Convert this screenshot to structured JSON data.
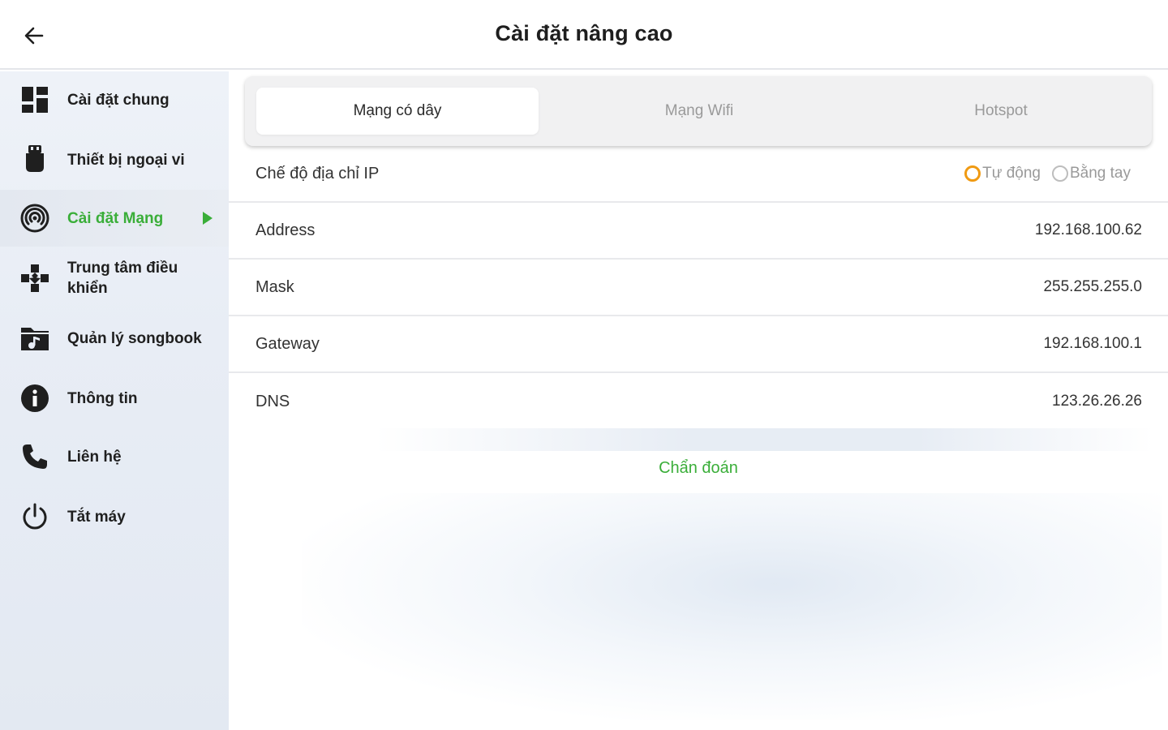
{
  "header": {
    "title": "Cài đặt nâng cao"
  },
  "sidebar": {
    "items": [
      {
        "label": "Cài đặt chung",
        "icon": "dashboard-icon"
      },
      {
        "label": "Thiết bị ngoại vi",
        "icon": "peripheral-icon"
      },
      {
        "label": "Cài đặt Mạng",
        "icon": "network-icon",
        "active": true
      },
      {
        "label": "Trung tâm điều khiển",
        "icon": "gamepad-icon"
      },
      {
        "label": "Quản lý songbook",
        "icon": "music-folder-icon"
      },
      {
        "label": "Thông tin",
        "icon": "info-icon"
      },
      {
        "label": "Liên hệ",
        "icon": "phone-icon"
      },
      {
        "label": "Tắt máy",
        "icon": "power-icon"
      }
    ]
  },
  "tabs": [
    {
      "label": "Mạng có dây",
      "active": true
    },
    {
      "label": "Mạng Wifi"
    },
    {
      "label": "Hotspot"
    }
  ],
  "ip_mode": {
    "label": "Chế độ địa chỉ IP",
    "options": [
      "Tự động",
      "Bằng tay"
    ],
    "selected": "Tự động"
  },
  "fields": [
    {
      "key": "Address",
      "value": "192.168.100.62"
    },
    {
      "key": "Mask",
      "value": "255.255.255.0"
    },
    {
      "key": "Gateway",
      "value": "192.168.100.1"
    },
    {
      "key": "DNS",
      "value": "123.26.26.26"
    }
  ],
  "diagnose_label": "Chẩn đoán",
  "colors": {
    "accent": "#3aae39",
    "radio_on": "#f09a12",
    "sidebar_bg": "#e8edf5"
  }
}
